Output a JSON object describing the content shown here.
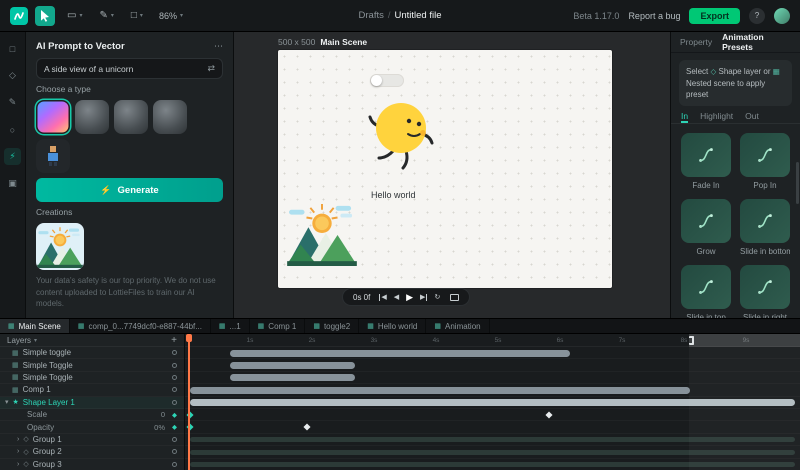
{
  "toolbar": {
    "zoom": "86%",
    "drafts": "Drafts",
    "separator": "/",
    "file_name": "Untitled file",
    "beta": "Beta 1.17.0",
    "report_bug": "Report a bug",
    "export_label": "Export"
  },
  "icons": {
    "frame_tool": "▭",
    "pen_tool": "✎",
    "shape_tool": "□",
    "caret": "▾",
    "more": "⋯",
    "shuffle": "⇄",
    "generate_spark": "⚡",
    "plus": "+",
    "layers_caret": "▾",
    "help": "?"
  },
  "left_strip": {
    "icons": [
      {
        "name": "select-icon",
        "glyph": "□"
      },
      {
        "name": "shapes-icon",
        "glyph": "◇"
      },
      {
        "name": "draw-icon",
        "glyph": "✎"
      },
      {
        "name": "character-icon",
        "glyph": "○"
      },
      {
        "name": "ai-prompt-icon",
        "glyph": "⚡",
        "active": true
      },
      {
        "name": "assets-icon",
        "glyph": "▣"
      }
    ]
  },
  "ai_panel": {
    "title": "AI Prompt to Vector",
    "prompt_value": "A side view of a unicorn",
    "choose_type_label": "Choose a type",
    "styles": [
      {
        "kind": "gradient",
        "selected": true
      },
      {
        "kind": "animal"
      },
      {
        "kind": "animal"
      },
      {
        "kind": "animal"
      },
      {
        "kind": "pixel"
      }
    ],
    "generate_label": "Generate",
    "creations_label": "Creations",
    "disclaimer": "Your data's safety is our top priority. We do not use content uploaded to LottieFiles to train our AI models."
  },
  "canvas": {
    "size_label": "500 x 500",
    "scene_name": "Main Scene",
    "hello_text": "Hello world"
  },
  "playback": {
    "time": "0s 0f",
    "icons": [
      {
        "name": "skip-to-start-icon",
        "glyph": "◀"
      },
      {
        "name": "previous-frame-icon",
        "glyph": "◀"
      },
      {
        "name": "play-icon",
        "glyph": "▶"
      },
      {
        "name": "next-frame-icon",
        "glyph": "▶"
      },
      {
        "name": "loop-icon",
        "glyph": "↻"
      }
    ]
  },
  "right_panel": {
    "tabs": [
      {
        "label": "Property"
      },
      {
        "label": "Animation Presets",
        "active": true
      }
    ],
    "hint": {
      "part1": "Select",
      "shape_icon": "◇",
      "part2": "Shape layer or",
      "nested_icon": "▦",
      "part3": "Nested scene to apply preset"
    },
    "preset_tabs": [
      {
        "label": "In",
        "active": true
      },
      {
        "label": "Highlight"
      },
      {
        "label": "Out"
      }
    ],
    "presets": [
      {
        "label": "Fade In"
      },
      {
        "label": "Pop In"
      },
      {
        "label": "Grow"
      },
      {
        "label": "Slide in bottom"
      },
      {
        "label": "Slide in top"
      },
      {
        "label": "Slide in right"
      }
    ]
  },
  "timeline": {
    "tabs": [
      {
        "label": "Main Scene",
        "active": true
      },
      {
        "label": "comp_0...7749dcf0-e887-44bf..."
      },
      {
        "label": "...1"
      },
      {
        "label": "Comp 1"
      },
      {
        "label": "toggle2"
      },
      {
        "label": "Hello world"
      },
      {
        "label": "Animation"
      }
    ],
    "layers_header": "Layers",
    "ruler_ticks": [
      "1s",
      "2s",
      "3s",
      "4s",
      "5s",
      "6s",
      "7s",
      "8s",
      "9s"
    ],
    "icon_glyphs": {
      "comp": "▦",
      "shape": "★",
      "group": "◇",
      "keyframe": "◆"
    },
    "layers": [
      {
        "name": "Simple toggle",
        "type": "comp",
        "bar": {
          "left": 7.3,
          "width": 55.3
        }
      },
      {
        "name": "Simple Toggle",
        "type": "comp",
        "bar": {
          "left": 7.3,
          "width": 20.3
        }
      },
      {
        "name": "Simple Toggle",
        "type": "comp",
        "bar": {
          "left": 7.3,
          "width": 20.3
        }
      },
      {
        "name": "Comp 1",
        "type": "comp",
        "bar": {
          "left": 0.8,
          "width": 81.3
        }
      },
      {
        "name": "Shape Layer 1",
        "type": "shape",
        "selected": true,
        "expanded": true,
        "bar": {
          "left": 0.8,
          "width": 98.4
        }
      },
      {
        "name": "Scale",
        "type": "property",
        "value": "0",
        "keyframes": [
          {
            "pos": 0.8,
            "current": true
          },
          {
            "pos": 59.2
          }
        ]
      },
      {
        "name": "Opacity",
        "type": "property",
        "value": "0%",
        "keyframes": [
          {
            "pos": 0.8,
            "current": true
          },
          {
            "pos": 19.8
          }
        ]
      },
      {
        "name": "Group 1",
        "type": "group",
        "bar": {
          "left": 0.8,
          "width": 98.4
        }
      },
      {
        "name": "Group 2",
        "type": "group",
        "bar": {
          "left": 0.8,
          "width": 98.4
        }
      },
      {
        "name": "Group 3",
        "type": "group",
        "bar": {
          "left": 0.8,
          "width": 98.4
        }
      }
    ],
    "playhead_percent": 0.5,
    "work_area_end_percent": 82
  },
  "colors": {
    "accent_teal": "#1bc0a4",
    "export_green": "#00c875",
    "playhead_orange": "#ff7847"
  }
}
